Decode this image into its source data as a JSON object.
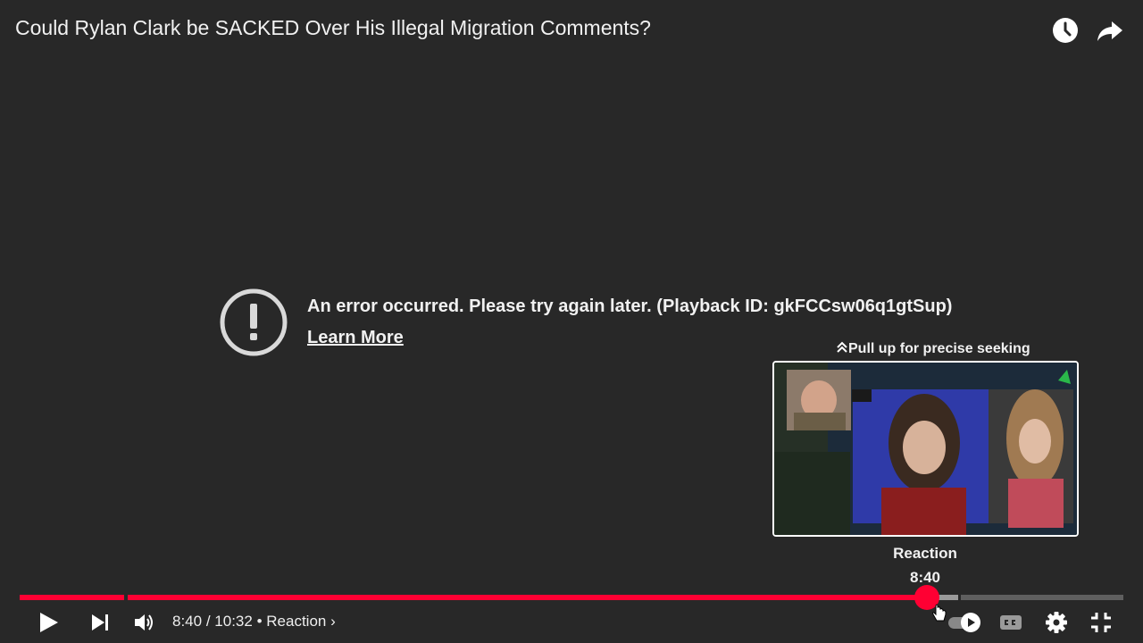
{
  "video": {
    "title": "Could Rylan Clark be SACKED Over His Illegal Migration Comments?"
  },
  "top_actions": {
    "watch_later_icon": "clock-icon",
    "share_icon": "share-arrow-icon"
  },
  "error": {
    "icon": "exclamation-circle-icon",
    "message": "An error occurred. Please try again later. (Playback ID: gkFCCsw06q1gtSup)",
    "learn_more": "Learn More"
  },
  "seek_preview": {
    "hint": "Pull up for precise seeking",
    "chapter": "Reaction",
    "time": "8:40"
  },
  "progress": {
    "current_seconds": 520,
    "duration_seconds": 632,
    "played_color": "#ff0033",
    "hover_color": "#9a9a9a",
    "unplayed_color": "#5f5f5f"
  },
  "controls": {
    "current_time": "8:40",
    "separator": "/",
    "duration": "10:32",
    "dot": "•",
    "chapter": "Reaction",
    "chapter_chevron": "›"
  },
  "colors": {
    "background": "#282828",
    "accent": "#ff0033",
    "text": "#f1f1f1"
  }
}
